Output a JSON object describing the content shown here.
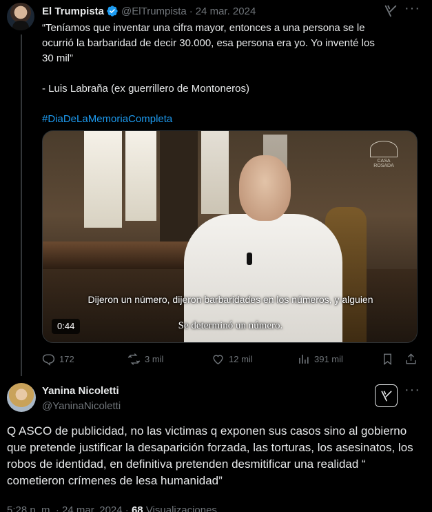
{
  "quoted_tweet": {
    "author_name": "El Trumpista",
    "author_handle": "@ElTrumpista",
    "separator": "·",
    "date": "24 mar. 2024",
    "text_lines": [
      "“Teníamos que inventar una cifra mayor, entonces a una persona se le",
      "ocurrió la barbaridad de decir 30.000, esa persona era yo. Yo inventé los",
      "30 mil”"
    ],
    "attribution": "- Luis Labraña (ex guerrillero de Montoneros)",
    "hashtag": "#DiaDeLaMemoriaCompleta",
    "video": {
      "subtitle_top": "Dijeron un número, dijeron barbaridades en los números, y alguien",
      "subtitle_bottom": "Se determinó un número.",
      "duration": "0:44",
      "watermark": "CASA ROSADA"
    },
    "actions": {
      "replies": "172",
      "retweets": "3 mil",
      "likes": "12 mil",
      "views": "391 mil"
    },
    "icons": [
      "verified-badge-icon",
      "grok-icon",
      "more-icon",
      "reply-icon",
      "retweet-icon",
      "like-icon",
      "views-icon",
      "bookmark-icon",
      "share-icon"
    ]
  },
  "main_tweet": {
    "author_name": "Yanina Nicoletti",
    "author_handle": "@YaninaNicoletti",
    "text": "Q ASCO de publicidad, no las victimas q exponen sus casos sino al gobierno que pretende justificar la desaparición forzada, las torturas, los asesinatos, los robos de identidad, en definitiva pretenden desmitificar una realidad “ cometieron crímenes de lesa humanidad”",
    "time": "5:28 p. m.",
    "separator": "·",
    "date": "24 mar. 2024",
    "views_count": "68",
    "views_label": "Visualizaciones"
  },
  "colors": {
    "background": "#000000",
    "text": "#e7e9ea",
    "secondary": "#71767b",
    "link": "#1d9bf0",
    "divider": "#2f3336"
  }
}
